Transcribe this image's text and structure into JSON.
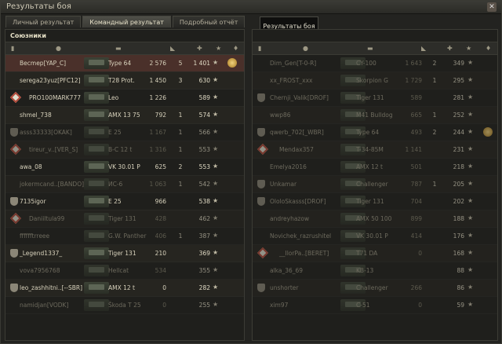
{
  "window": {
    "title": "Результаты боя"
  },
  "tabs": [
    "Личный результат",
    "Командный результат",
    "Подробный отчёт"
  ],
  "tooltip": "Результаты боя",
  "left": {
    "title": "Союзники",
    "rows": [
      {
        "name": "Becmep[YAP_C]",
        "tank": "Type 64",
        "dmg": "2 576",
        "frags": "5",
        "xp": "1 401",
        "self": true,
        "medal": true
      },
      {
        "name": "serega23yuz[PFC12]",
        "tank": "T28 Prot.",
        "dmg": "1 450",
        "frags": "3",
        "xp": "630"
      },
      {
        "name": "PRO100MARK777",
        "tank": "Leo",
        "dmg": "1 226",
        "frags": "",
        "xp": "589",
        "plat": true
      },
      {
        "name": "shmel_738",
        "tank": "AMX 13 75",
        "dmg": "792",
        "frags": "1",
        "xp": "574"
      },
      {
        "name": "asss33333[OKAK]",
        "tank": "E 25",
        "dmg": "1 167",
        "frags": "1",
        "xp": "566",
        "clan": true,
        "dead": true
      },
      {
        "name": "tireur_v..[VER_S]",
        "tank": "B-C 12 t",
        "dmg": "1 316",
        "frags": "1",
        "xp": "553",
        "plat": true,
        "dead": true
      },
      {
        "name": "awa_08",
        "tank": "VK 30.01 P",
        "dmg": "625",
        "frags": "2",
        "xp": "553"
      },
      {
        "name": "jokermcand..[BANDO]",
        "tank": "ИС-6",
        "dmg": "1 063",
        "frags": "1",
        "xp": "542",
        "dead": true
      },
      {
        "name": "7135igor",
        "tank": "E 25",
        "dmg": "966",
        "frags": "",
        "xp": "538",
        "clan": true
      },
      {
        "name": "Daniiltula99",
        "tank": "Tiger 131",
        "dmg": "428",
        "frags": "",
        "xp": "462",
        "plat": true,
        "dead": true
      },
      {
        "name": "fffffftrreee",
        "tank": "G.W. Panther",
        "dmg": "406",
        "frags": "1",
        "xp": "387",
        "dead": true
      },
      {
        "name": "_Legend1337_",
        "tank": "Tiger 131",
        "dmg": "210",
        "frags": "",
        "xp": "369",
        "clan": true
      },
      {
        "name": "vova7956768",
        "tank": "Hellcat",
        "dmg": "534",
        "frags": "",
        "xp": "355",
        "dead": true
      },
      {
        "name": "leo_zashhitni..[--SBR]",
        "tank": "AMX 12 t",
        "dmg": "0",
        "frags": "",
        "xp": "282",
        "clan": true
      },
      {
        "name": "namidjan[VODK]",
        "tank": "Škoda T 25",
        "dmg": "0",
        "frags": "",
        "xp": "255",
        "dead": true
      }
    ]
  },
  "right": {
    "rows": [
      {
        "name": "Dim_Gen[T-0-R]",
        "tank": "CY-100",
        "dmg": "1 643",
        "frags": "2",
        "xp": "349",
        "dead": true
      },
      {
        "name": "xx_FROST_xxx",
        "tank": "Skorpion G",
        "dmg": "1 729",
        "frags": "1",
        "xp": "295",
        "dead": true
      },
      {
        "name": "Chernji_Valik[DROF]",
        "tank": "Tiger 131",
        "dmg": "589",
        "frags": "",
        "xp": "281",
        "clan": true,
        "dead": true
      },
      {
        "name": "wwp86",
        "tank": "M41 Bulldog",
        "dmg": "665",
        "frags": "1",
        "xp": "252",
        "dead": true
      },
      {
        "name": "qwerb_702[_WBR]",
        "tank": "Type 64",
        "dmg": "493",
        "frags": "2",
        "xp": "244",
        "clan": true,
        "dead": true,
        "medal": true
      },
      {
        "name": "Mendax357",
        "tank": "T-34-85M",
        "dmg": "1 141",
        "frags": "",
        "xp": "231",
        "plat": true,
        "dead": true
      },
      {
        "name": "Emelya2016",
        "tank": "AMX 12 t",
        "dmg": "501",
        "frags": "",
        "xp": "218",
        "dead": true
      },
      {
        "name": "Unkamar",
        "tank": "Challenger",
        "dmg": "787",
        "frags": "1",
        "xp": "205",
        "clan": true,
        "dead": true
      },
      {
        "name": "OloloSkasss[DROF]",
        "tank": "Tiger 131",
        "dmg": "704",
        "frags": "",
        "xp": "202",
        "clan": true,
        "dead": true
      },
      {
        "name": "andreyhazow",
        "tank": "AMX 50 100",
        "dmg": "899",
        "frags": "",
        "xp": "188",
        "dead": true
      },
      {
        "name": "Novichek_razrushitel",
        "tank": "VK 30.01 P",
        "dmg": "414",
        "frags": "",
        "xp": "176",
        "dead": true
      },
      {
        "name": "__IlorPa..[BERET]",
        "tank": "T71 DA",
        "dmg": "0",
        "frags": "",
        "xp": "168",
        "plat": true,
        "dead": true
      },
      {
        "name": "alka_36_69",
        "tank": "KB-13",
        "dmg": "",
        "frags": "",
        "xp": "88",
        "dead": true
      },
      {
        "name": "unshorter",
        "tank": "Challenger",
        "dmg": "266",
        "frags": "",
        "xp": "86",
        "clan": true,
        "dead": true
      },
      {
        "name": "xim97",
        "tank": "C-51",
        "dmg": "0",
        "frags": "",
        "xp": "59",
        "dead": true
      }
    ]
  }
}
